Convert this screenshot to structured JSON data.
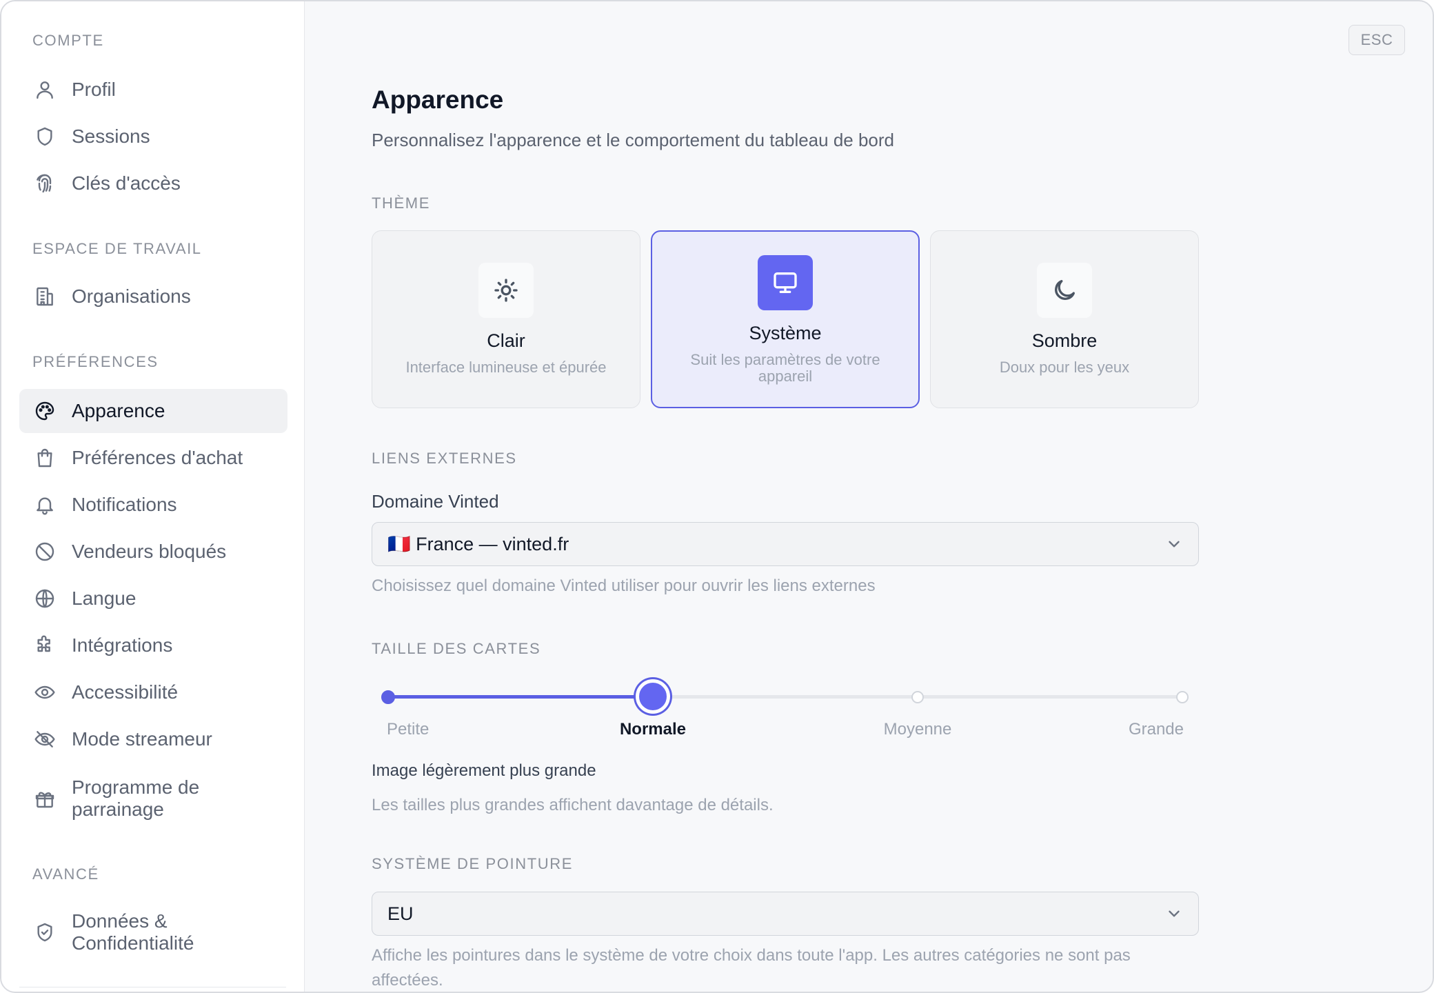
{
  "sidebar": {
    "sections": [
      {
        "label": "COMPTE",
        "items": [
          {
            "label": "Profil",
            "icon": "user-icon"
          },
          {
            "label": "Sessions",
            "icon": "shield-icon"
          },
          {
            "label": "Clés d'accès",
            "icon": "fingerprint-icon"
          }
        ]
      },
      {
        "label": "ESPACE DE TRAVAIL",
        "items": [
          {
            "label": "Organisations",
            "icon": "building-icon"
          }
        ]
      },
      {
        "label": "PRÉFÉRENCES",
        "items": [
          {
            "label": "Apparence",
            "icon": "palette-icon",
            "active": true
          },
          {
            "label": "Préférences d'achat",
            "icon": "shopping-bag-icon"
          },
          {
            "label": "Notifications",
            "icon": "bell-icon"
          },
          {
            "label": "Vendeurs bloqués",
            "icon": "ban-icon"
          },
          {
            "label": "Langue",
            "icon": "globe-icon"
          },
          {
            "label": "Intégrations",
            "icon": "puzzle-icon"
          },
          {
            "label": "Accessibilité",
            "icon": "eye-icon"
          },
          {
            "label": "Mode streameur",
            "icon": "eye-off-icon"
          },
          {
            "label": "Programme de parrainage",
            "icon": "gift-icon"
          }
        ]
      },
      {
        "label": "AVANCÉ",
        "items": [
          {
            "label": "Données & Confidentialité",
            "icon": "shield-check-icon"
          }
        ]
      }
    ]
  },
  "header": {
    "esc_label": "ESC"
  },
  "page": {
    "title": "Apparence",
    "subtitle": "Personnalisez l'apparence et le comportement du tableau de bord"
  },
  "theme": {
    "section_label": "THÈME",
    "options": [
      {
        "title": "Clair",
        "description": "Interface lumineuse et épurée",
        "icon": "sun-icon"
      },
      {
        "title": "Système",
        "description": "Suit les paramètres de votre appareil",
        "icon": "monitor-icon",
        "selected": true
      },
      {
        "title": "Sombre",
        "description": "Doux pour les yeux",
        "icon": "moon-icon"
      }
    ],
    "accent_color": "#6366f1"
  },
  "external_links": {
    "section_label": "LIENS EXTERNES",
    "field_label": "Domaine Vinted",
    "selected_value": "🇫🇷 France — vinted.fr",
    "help": "Choisissez quel domaine Vinted utiliser pour ouvrir les liens externes"
  },
  "card_size": {
    "section_label": "TAILLE DES CARTES",
    "stops": [
      "Petite",
      "Normale",
      "Moyenne",
      "Grande"
    ],
    "selected_index": 1,
    "selected_description": "Image légèrement plus grande",
    "help": "Les tailles plus grandes affichent davantage de détails."
  },
  "shoe_size": {
    "section_label": "SYSTÈME DE POINTURE",
    "selected_value": "EU",
    "help": "Affiche les pointures dans le système de votre choix dans toute l'app. Les autres catégories ne sont pas affectées."
  }
}
